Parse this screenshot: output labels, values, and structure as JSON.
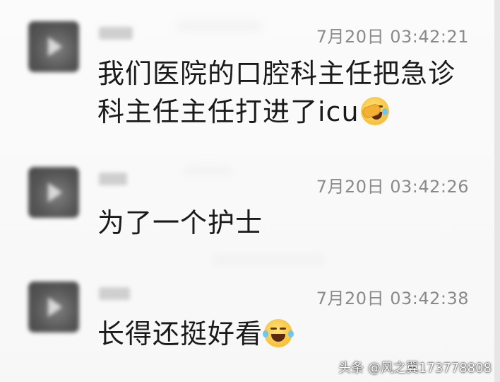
{
  "messages": [
    {
      "timestamp": "7月20日 03:42:21",
      "text_line1": "我们医院的口腔科主任把急诊",
      "text_line2": "科主任主任打进了icu",
      "emoji": "facepalm-cry-emoji"
    },
    {
      "timestamp": "7月20日 03:42:26",
      "text_line1": "为了一个护士"
    },
    {
      "timestamp": "7月20日 03:42:38",
      "text_line1": "长得还挺好看",
      "emoji": "laughing-tears-emoji"
    }
  ],
  "watermark": "头条 @风之翼173778808"
}
